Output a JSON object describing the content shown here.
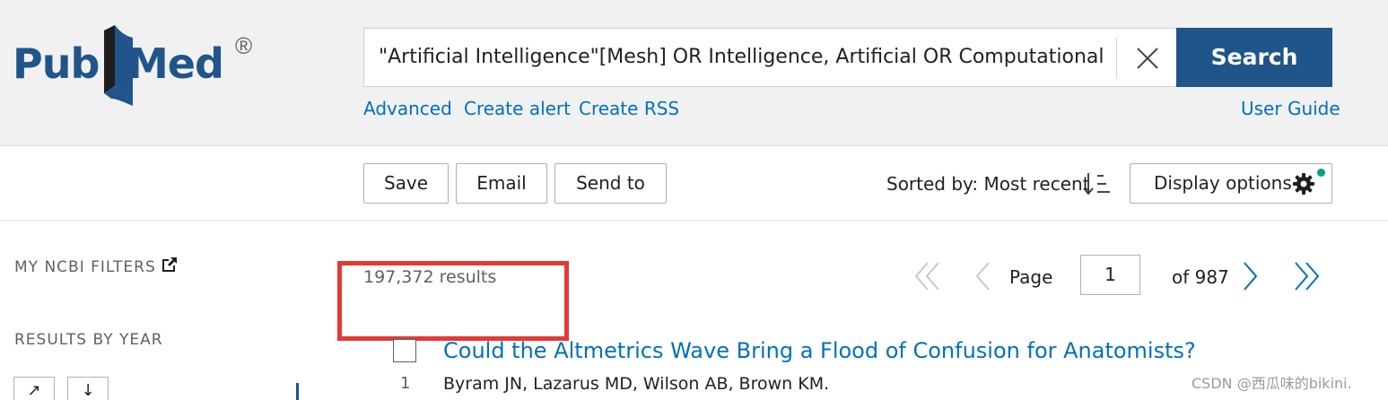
{
  "header": {
    "logo": {
      "part1": "Pub",
      "part2": "Med",
      "registered": "®"
    },
    "search": {
      "value": "\"Artificial Intelligence\"[Mesh] OR Intelligence, Artificial OR Computational Int",
      "button_label": "Search"
    },
    "links": {
      "advanced": "Advanced",
      "create_alert": "Create alert",
      "create_rss": "Create RSS",
      "user_guide": "User Guide"
    }
  },
  "toolbar": {
    "save": "Save",
    "email": "Email",
    "send_to": "Send to",
    "sorted_by": "Sorted by: Most recent",
    "display_options": "Display options"
  },
  "sidebar": {
    "my_ncbi_filters": "MY NCBI FILTERS",
    "results_by_year": "RESULTS BY YEAR",
    "expand_icon": "↗",
    "download_icon": "↓"
  },
  "results": {
    "count": "197,372 results",
    "pagination": {
      "page_label": "Page",
      "current_page": "1",
      "of_label": "of 987"
    },
    "items": [
      {
        "number": "1",
        "title": "Could the Altmetrics Wave Bring a Flood of Confusion for Anatomists?",
        "authors": "Byram JN, Lazarus MD, Wilson AB, Brown KM."
      }
    ]
  },
  "watermark": "CSDN @西瓜味的bikini.",
  "colors": {
    "brand": "#20558a",
    "link": "#0071bc",
    "header_bg": "#f1f1f1",
    "highlight": "#e53935",
    "dot": "#00a386"
  }
}
